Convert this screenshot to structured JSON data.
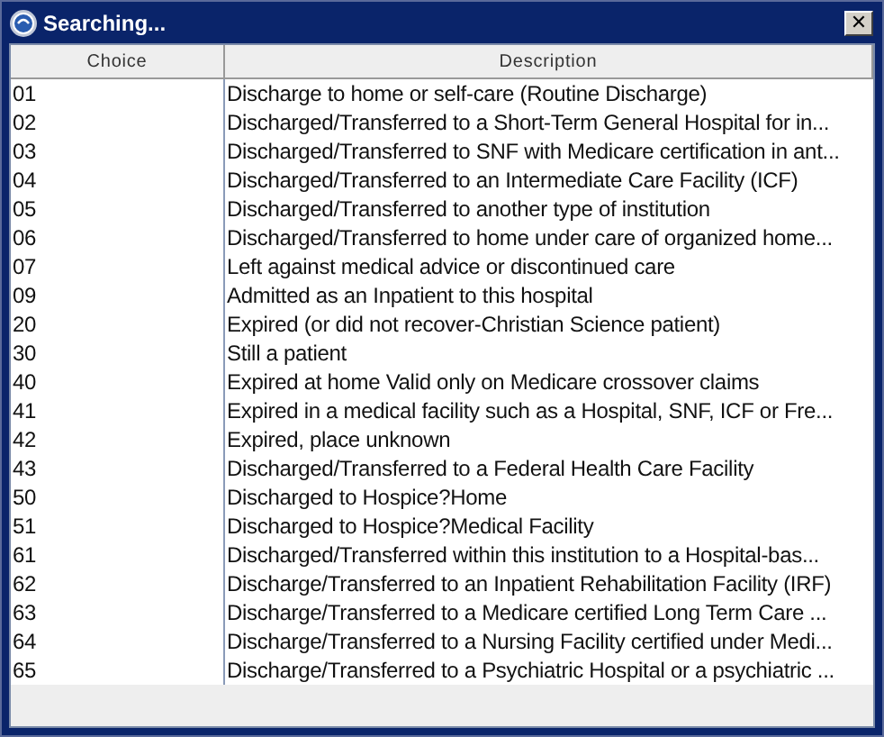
{
  "window": {
    "title": "Searching...",
    "close_label": "✕"
  },
  "table": {
    "columns": [
      "Choice",
      "Description"
    ],
    "rows": [
      [
        "01",
        "Discharge to home or self-care (Routine Discharge)"
      ],
      [
        "02",
        "Discharged/Transferred to a Short-Term General Hospital for in..."
      ],
      [
        "03",
        "Discharged/Transferred to SNF with Medicare certification in ant..."
      ],
      [
        "04",
        "Discharged/Transferred to an Intermediate Care Facility (ICF)"
      ],
      [
        "05",
        "Discharged/Transferred to another type of institution"
      ],
      [
        "06",
        "Discharged/Transferred to home under care of organized home..."
      ],
      [
        "07",
        "Left against medical advice or discontinued care"
      ],
      [
        "09",
        "Admitted as an Inpatient to this hospital"
      ],
      [
        "20",
        "Expired (or did not recover-Christian Science patient)"
      ],
      [
        "30",
        "Still a patient"
      ],
      [
        "40",
        "Expired at home Valid only on Medicare crossover claims"
      ],
      [
        "41",
        "Expired in a medical facility such as a Hospital, SNF, ICF or Fre..."
      ],
      [
        "42",
        "Expired, place unknown"
      ],
      [
        "43",
        "Discharged/Transferred to a Federal Health Care Facility"
      ],
      [
        "50",
        "Discharged to Hospice?Home"
      ],
      [
        "51",
        "Discharged to Hospice?Medical Facility"
      ],
      [
        "61",
        "Discharged/Transferred within this institution to a Hospital-bas..."
      ],
      [
        "62",
        "Discharge/Transferred to an Inpatient Rehabilitation Facility (IRF)"
      ],
      [
        "63",
        "Discharge/Transferred to a Medicare certified Long Term Care ..."
      ],
      [
        "64",
        "Discharge/Transferred to a Nursing Facility certified under Medi..."
      ],
      [
        "65",
        "Discharge/Transferred to a Psychiatric Hospital or a psychiatric ..."
      ]
    ]
  }
}
